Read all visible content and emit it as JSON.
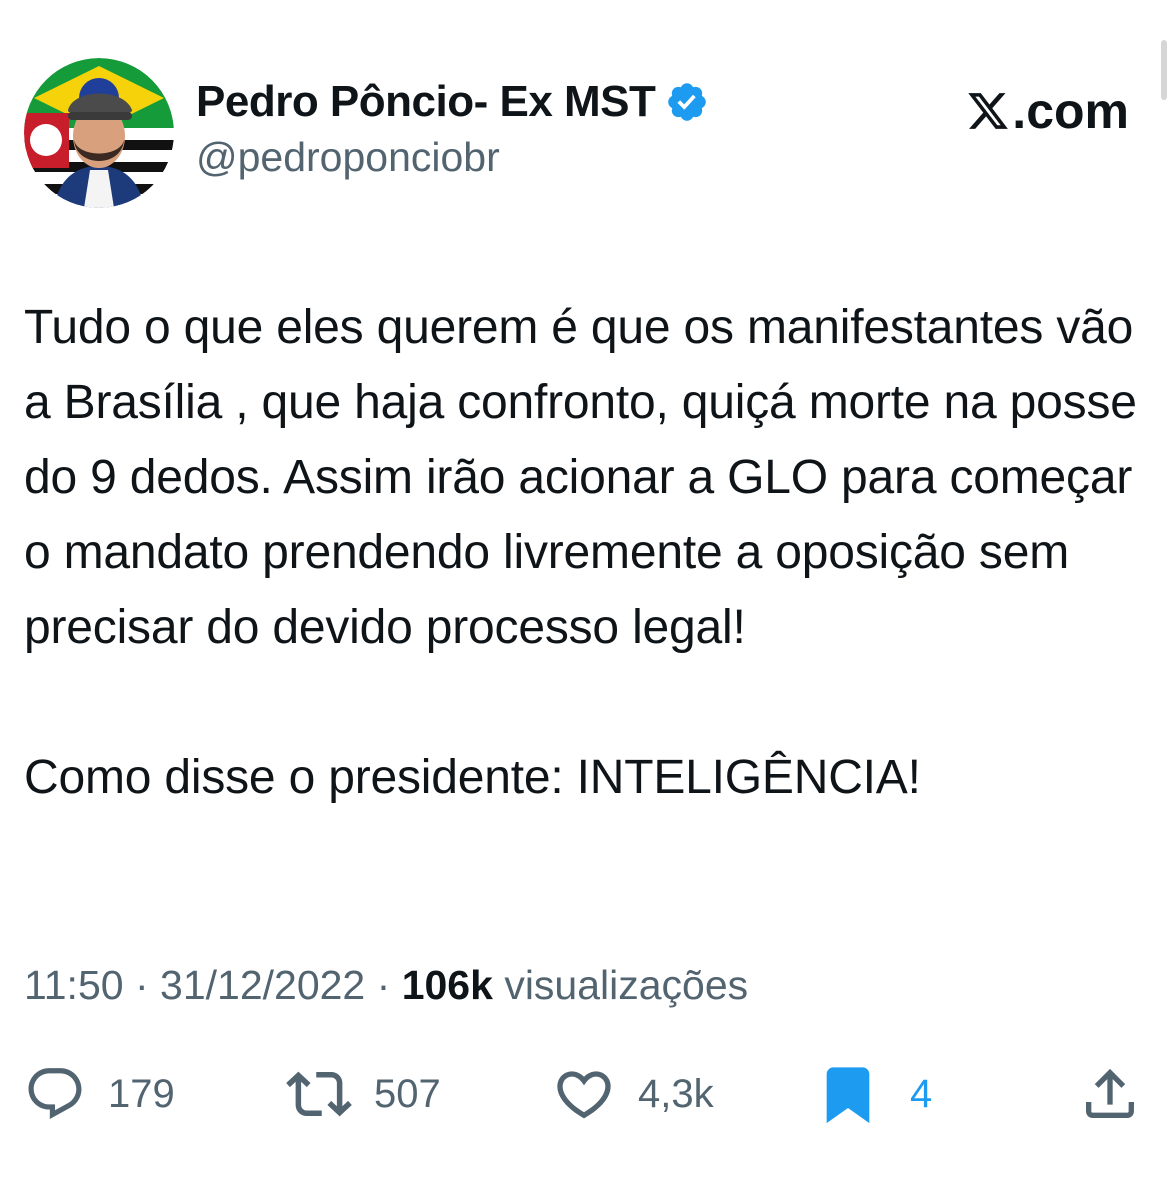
{
  "author": {
    "display_name": "Pedro Pôncio- Ex MST",
    "handle": "@pedroponciobr",
    "verified": true
  },
  "site_logo": {
    "text": ".com",
    "icon": "x-logo-icon"
  },
  "tweet": {
    "paragraphs": [
      "Tudo o que eles querem é que os manifestantes vão a Brasília , que haja confronto, quiçá morte na posse do 9 dedos. Assim irão acionar a GLO para começar o mandato prendendo livremente a oposição sem precisar do devido processo legal!",
      "Como disse o presidente: INTELIGÊNCIA!"
    ]
  },
  "meta": {
    "time": "11:50",
    "separator": "·",
    "date": "31/12/2022",
    "views_count": "106k",
    "views_label": "visualizações"
  },
  "actions": {
    "replies": "179",
    "reposts": "507",
    "likes": "4,3k",
    "bookmarks": "4"
  },
  "colors": {
    "text_primary": "#0f1419",
    "text_secondary": "#536471",
    "accent_blue": "#1d9bf0"
  }
}
